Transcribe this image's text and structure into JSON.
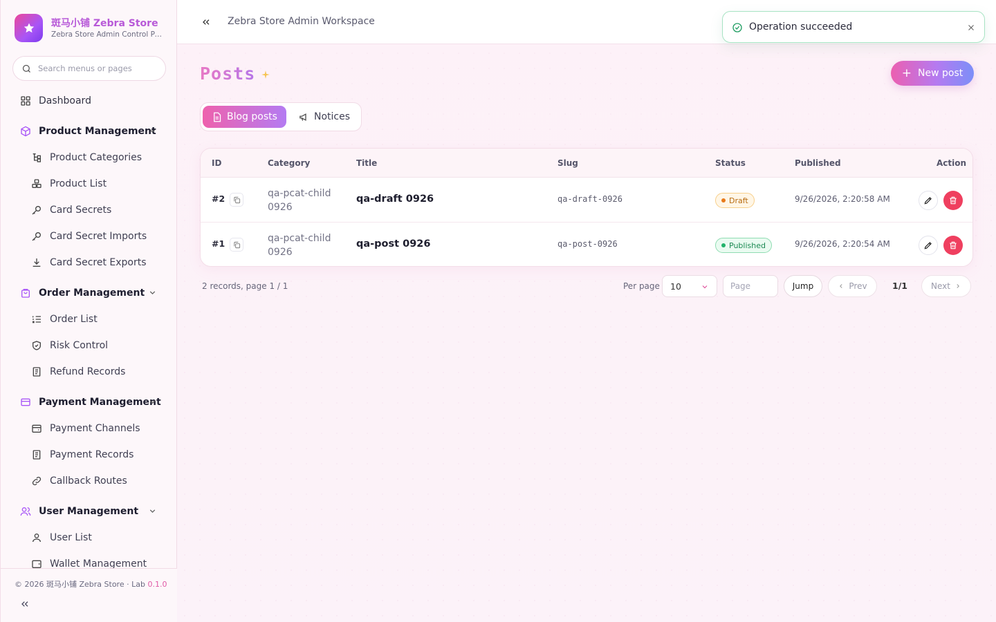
{
  "sidebar": {
    "brand_title": "斑马小铺 Zebra Store",
    "brand_subtitle": "Zebra Store Admin Control Panel",
    "search_placeholder": "Search menus or pages",
    "dashboard": "Dashboard",
    "product_management": "Product Management",
    "product_items": [
      "Product Categories",
      "Product List",
      "Card Secrets",
      "Card Secret Imports",
      "Card Secret Exports"
    ],
    "order_management": "Order Management",
    "order_items": [
      "Order List",
      "Risk Control",
      "Refund Records"
    ],
    "payment_management": "Payment Management",
    "payment_items": [
      "Payment Channels",
      "Payment Records",
      "Callback Routes"
    ],
    "user_management": "User Management",
    "user_items": [
      "User List",
      "Wallet Management"
    ],
    "copyright": "© 2026 斑马小铺 Zebra Store · Lab",
    "version": "0.1.0"
  },
  "topbar": {
    "workspace": "Zebra Store Admin Workspace"
  },
  "toast": {
    "message": "Operation succeeded"
  },
  "page": {
    "title": "Posts",
    "new_button": "New post",
    "tabs": [
      "Blog posts",
      "Notices"
    ]
  },
  "table": {
    "headers": {
      "id": "ID",
      "category": "Category",
      "title": "Title",
      "slug": "Slug",
      "status": "Status",
      "published": "Published",
      "action": "Action"
    },
    "rows": [
      {
        "id": "#2",
        "category": "qa-pcat-child 0926",
        "title": "qa-draft 0926",
        "slug": "qa-draft-0926",
        "status": "Draft",
        "published": "9/26/2026, 2:20:58 AM"
      },
      {
        "id": "#1",
        "category": "qa-pcat-child 0926",
        "title": "qa-post 0926",
        "slug": "qa-post-0926",
        "status": "Published",
        "published": "9/26/2026, 2:20:54 AM"
      }
    ]
  },
  "pager": {
    "info": "2 records, page 1 / 1",
    "per_page_label": "Per page",
    "per_page_value": "10",
    "page_placeholder": "Page",
    "jump": "Jump",
    "prev": "Prev",
    "current": "1/1",
    "next": "Next"
  },
  "colors": {
    "accent_pink": "#ec4899",
    "accent_purple": "#a855f7",
    "danger": "#ef3f5f",
    "success": "#22b36b",
    "warning": "#e87a1a"
  }
}
